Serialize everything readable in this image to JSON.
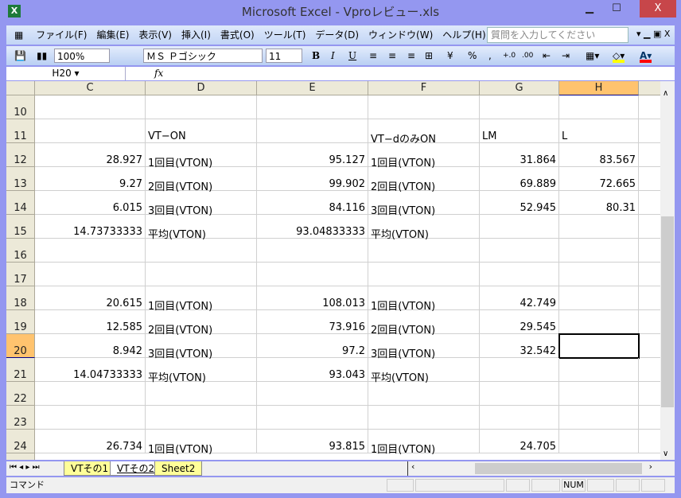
{
  "window": {
    "title": "Microsoft Excel - Vproレビュー.xls",
    "minimize": "▁",
    "maximize": "☐",
    "close": "X"
  },
  "menu": [
    "ファイル(F)",
    "編集(E)",
    "表示(V)",
    "挿入(I)",
    "書式(O)",
    "ツール(T)",
    "データ(D)",
    "ウィンドウ(W)",
    "ヘルプ(H)"
  ],
  "help_placeholder": "質問を入力してください",
  "toolbar": {
    "zoom": "100%",
    "font": "ＭＳ Ｐゴシック",
    "size": "11",
    "bold": "B",
    "italic": "I",
    "underline": "U",
    "percent": "%",
    "comma": ",",
    "fill_color": "#ffff00",
    "font_color": "#ff0000"
  },
  "formula_bar": {
    "name_box": "H20",
    "fx": "fx",
    "value": ""
  },
  "columns": [
    "C",
    "D",
    "E",
    "F",
    "G",
    "H"
  ],
  "selected_column": "H",
  "selected_row": "20",
  "rows": [
    {
      "n": "10",
      "c": [
        "",
        "",
        "",
        "",
        "",
        ""
      ]
    },
    {
      "n": "11",
      "c": [
        "",
        "VT−ON",
        "",
        "VT−dのみON",
        "LM",
        "L"
      ]
    },
    {
      "n": "12",
      "c": [
        "28.927",
        "1回目(VTON)",
        "95.127",
        "1回目(VTON)",
        "31.864",
        "83.567"
      ]
    },
    {
      "n": "13",
      "c": [
        "9.27",
        "2回目(VTON)",
        "99.902",
        "2回目(VTON)",
        "69.889",
        "72.665"
      ]
    },
    {
      "n": "14",
      "c": [
        "6.015",
        "3回目(VTON)",
        "84.116",
        "3回目(VTON)",
        "52.945",
        "80.31"
      ]
    },
    {
      "n": "15",
      "c": [
        "14.73733333",
        "平均(VTON)",
        "93.04833333",
        "平均(VTON)",
        "",
        ""
      ]
    },
    {
      "n": "16",
      "c": [
        "",
        "",
        "",
        "",
        "",
        ""
      ]
    },
    {
      "n": "17",
      "c": [
        "",
        "",
        "",
        "",
        "",
        ""
      ]
    },
    {
      "n": "18",
      "c": [
        "20.615",
        "1回目(VTON)",
        "108.013",
        "1回目(VTON)",
        "42.749",
        ""
      ]
    },
    {
      "n": "19",
      "c": [
        "12.585",
        "2回目(VTON)",
        "73.916",
        "2回目(VTON)",
        "29.545",
        ""
      ]
    },
    {
      "n": "20",
      "c": [
        "8.942",
        "3回目(VTON)",
        "97.2",
        "3回目(VTON)",
        "32.542",
        ""
      ]
    },
    {
      "n": "21",
      "c": [
        "14.04733333",
        "平均(VTON)",
        "93.043",
        "平均(VTON)",
        "",
        ""
      ]
    },
    {
      "n": "22",
      "c": [
        "",
        "",
        "",
        "",
        "",
        ""
      ]
    },
    {
      "n": "23",
      "c": [
        "",
        "",
        "",
        "",
        "",
        ""
      ]
    },
    {
      "n": "24",
      "c": [
        "26.734",
        "1回目(VTON)",
        "93.815",
        "1回目(VTON)",
        "24.705",
        ""
      ]
    }
  ],
  "sheets": [
    {
      "name": "VTその1",
      "active": false
    },
    {
      "name": "VTその2",
      "active": true
    },
    {
      "name": "Sheet2",
      "active": false
    }
  ],
  "status": {
    "mode": "コマンド",
    "num": "NUM"
  }
}
